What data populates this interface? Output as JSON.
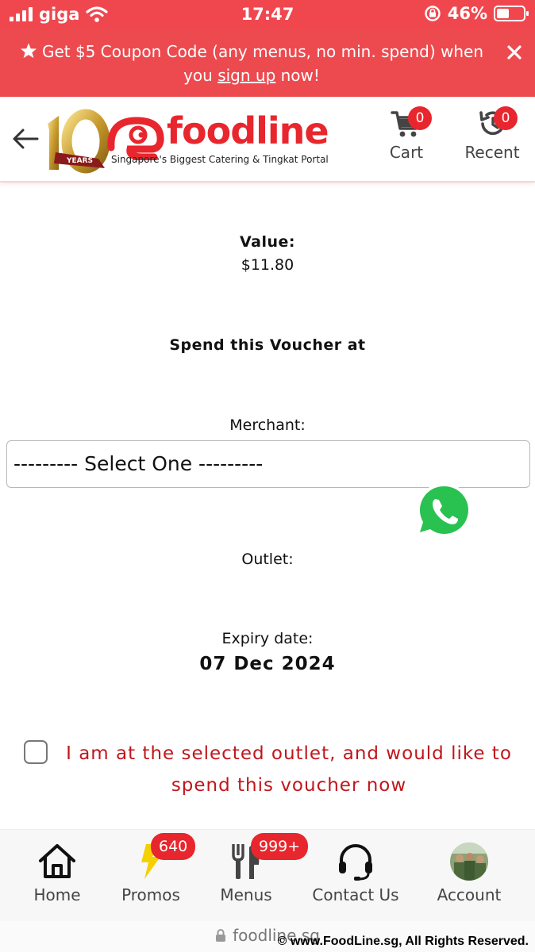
{
  "status_bar": {
    "carrier": "giga",
    "time": "17:47",
    "battery_percent_text": "46%",
    "battery_level": 0.46
  },
  "promo_banner": {
    "text_before_link": "Get $5 Coupon Code (any menus, no min. spend) when you ",
    "link_text": "sign up",
    "text_after_link": " now!",
    "icon": "star-icon",
    "close_icon": "close-icon"
  },
  "header": {
    "back_icon": "arrow-left-icon",
    "logo_years": "YEARS",
    "logo_text": "foodline",
    "logo_tagline": "Singapore's Biggest Catering & Tingkat Portal",
    "cart": {
      "label": "Cart",
      "count": "0",
      "icon": "cart-icon"
    },
    "recent": {
      "label": "Recent",
      "count": "0",
      "icon": "history-icon"
    }
  },
  "voucher": {
    "value_label": "Value:",
    "value_amount": "$11.80",
    "spend_title": "Spend this Voucher at",
    "merchant_label": "Merchant:",
    "merchant_select_value": "--------- Select One ---------",
    "outlet_label": "Outlet:",
    "expiry_label": "Expiry date:",
    "expiry_date": "07 Dec 2024",
    "confirm_text": "I am at the selected outlet, and would like to spend this voucher now"
  },
  "floating": {
    "whatsapp_icon": "whatsapp-icon"
  },
  "bottom_nav": {
    "items": [
      {
        "label": "Home",
        "icon": "home-icon"
      },
      {
        "label": "Promos",
        "icon": "lightning-icon",
        "badge": "640"
      },
      {
        "label": "Menus",
        "icon": "fork-knife-icon",
        "badge": "999+"
      },
      {
        "label": "Contact Us",
        "icon": "headset-icon"
      },
      {
        "label": "Account",
        "icon": "avatar"
      }
    ]
  },
  "url_bar": {
    "url": "foodline.sg"
  },
  "watermark": "© www.FoodLine.sg, All Rights Reserved.",
  "colors": {
    "brand_red": "#e8262d",
    "banner_red": "#ec4a4f",
    "confirm_red": "#c0161c"
  }
}
